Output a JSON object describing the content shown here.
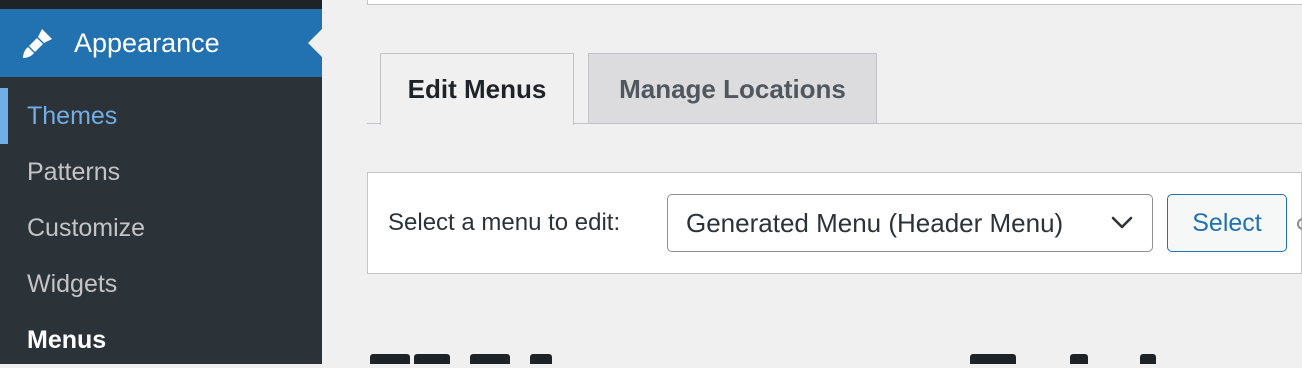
{
  "sidebar": {
    "section_label": "Appearance",
    "section_icon": "paintbrush-icon",
    "items": [
      {
        "label": "Themes"
      },
      {
        "label": "Patterns"
      },
      {
        "label": "Customize"
      },
      {
        "label": "Widgets"
      },
      {
        "label": "Menus"
      }
    ]
  },
  "tabs": [
    {
      "label": "Edit Menus",
      "active": true
    },
    {
      "label": "Manage Locations",
      "active": false
    }
  ],
  "menu_selector": {
    "label": "Select a menu to edit:",
    "selected": "Generated Menu (Header Menu)",
    "button_label": "Select"
  },
  "colors": {
    "sidebar_bg": "#2c3338",
    "accent": "#2271b1",
    "highlight": "#72aee6",
    "page_bg": "#f0f0f1"
  }
}
